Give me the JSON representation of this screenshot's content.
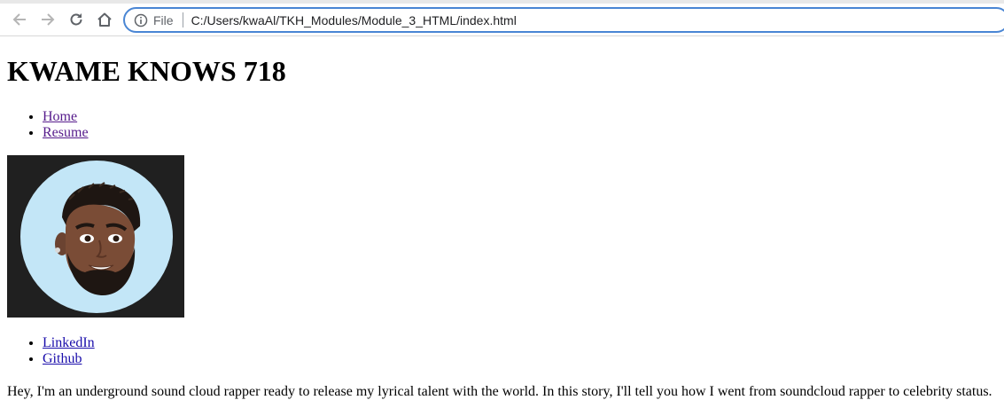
{
  "browser": {
    "file_label": "File",
    "url": "C:/Users/kwaAl/TKH_Modules/Module_3_HTML/index.html"
  },
  "page": {
    "title": "KWAME KNOWS 718",
    "nav_links": [
      {
        "label": "Home"
      },
      {
        "label": "Resume"
      }
    ],
    "social_links": [
      {
        "label": "LinkedIn"
      },
      {
        "label": "Github"
      }
    ],
    "bio": "Hey, I'm an underground sound cloud rapper ready to release my lyrical talent with the world. In this story, I'll tell you how I went from soundcloud rapper to celebrity status."
  },
  "colors": {
    "visited_link": "#551a8b",
    "link": "#1a0dab",
    "avatar_bg": "#202020",
    "avatar_circle": "#c3e6f7",
    "omnibox_border": "#4a86d4"
  }
}
